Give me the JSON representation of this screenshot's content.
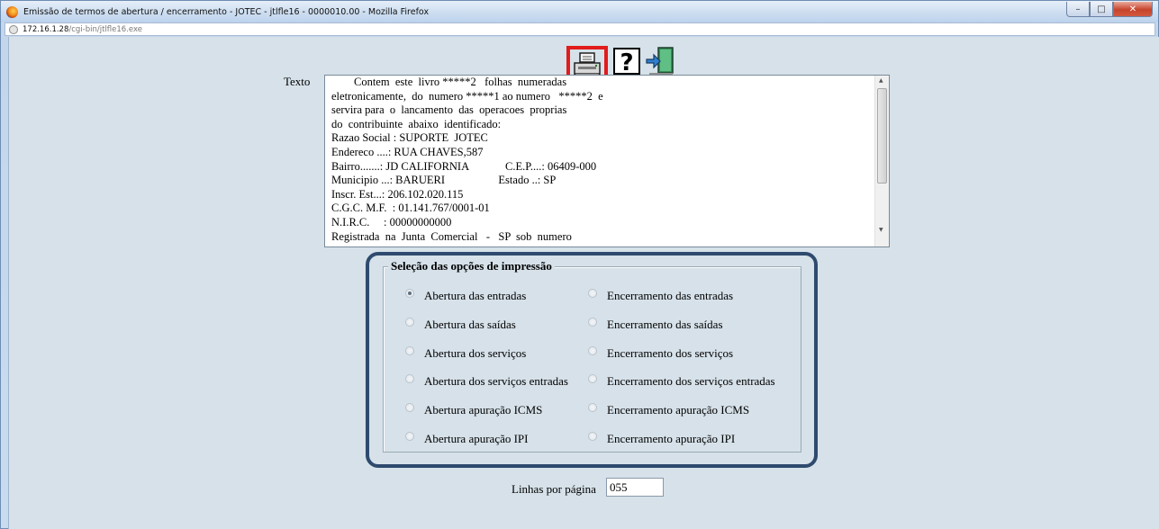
{
  "window": {
    "title": "Emissão de termos de abertura / encerramento - JOTEC - jtlfle16 - 0000010.00 - Mozilla Firefox",
    "minimize": "–",
    "maximize": "□",
    "close": "✕"
  },
  "urlbar": {
    "host": "172.16.1.28",
    "path": "/cgi-bin/jtlfle16.exe"
  },
  "toolbar": {
    "icons": [
      "printer-icon",
      "help-icon",
      "exit-icon"
    ]
  },
  "texto": {
    "label": "Texto",
    "lines": [
      "        Contem  este  livro *****2   folhas  numeradas",
      "eletronicamente,  do  numero *****1 ao numero   *****2  e",
      "servira para  o  lancamento  das  operacoes  proprias",
      "do  contribuinte  abaixo  identificado:",
      "Razao Social : SUPORTE  JOTEC",
      "Endereco ....: RUA CHAVES,587",
      "Bairro.......: JD CALIFORNIA             C.E.P....: 06409-000",
      "Municipio ...: BARUERI                   Estado ..: SP",
      "Inscr. Est...: 206.102.020.115",
      "C.G.C. M.F.  : 01.141.767/0001-01",
      "N.I.R.C.     : 00000000000",
      "Registrada  na  Junta  Comercial   -   SP  sob  numero"
    ]
  },
  "options": {
    "legend": "Seleção das opções de impressão",
    "left": [
      {
        "label": "Abertura das entradas",
        "checked": true
      },
      {
        "label": "Abertura das saídas",
        "checked": false
      },
      {
        "label": "Abertura dos serviços",
        "checked": false
      },
      {
        "label": "Abertura dos serviços entradas",
        "checked": false
      },
      {
        "label": "Abertura apuração ICMS",
        "checked": false
      },
      {
        "label": "Abertura apuração IPI",
        "checked": false
      }
    ],
    "right": [
      {
        "label": "Encerramento das entradas",
        "checked": false
      },
      {
        "label": "Encerramento das saídas",
        "checked": false
      },
      {
        "label": "Encerramento dos serviços",
        "checked": false
      },
      {
        "label": "Encerramento dos serviços entradas",
        "checked": false
      },
      {
        "label": "Encerramento apuração ICMS",
        "checked": false
      },
      {
        "label": "Encerramento apuração IPI",
        "checked": false
      }
    ]
  },
  "lines_per_page": {
    "label": "Linhas por página",
    "value": "055"
  },
  "colors": {
    "highlight": "#e21b1b",
    "frame": "#2e4a6e",
    "background": "#d6e1e9"
  }
}
